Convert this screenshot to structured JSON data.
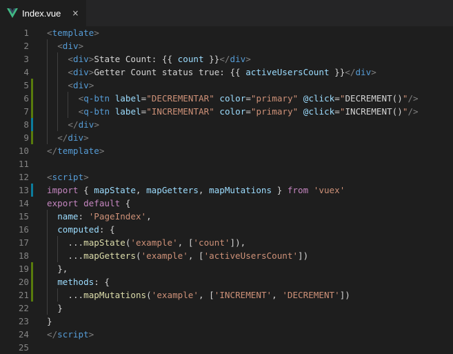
{
  "tab": {
    "label": "Index.vue",
    "close": "×",
    "icon": "vue-logo-icon",
    "vue_colors": [
      "#41b883",
      "#34495e"
    ]
  },
  "colors": {
    "background": "#1e1e1e",
    "gutter_text": "#858585",
    "git_modified": "#587c0c",
    "git_added": "#0c7d9d"
  },
  "lines": [
    {
      "n": "1",
      "marker": "",
      "indent": 0,
      "tokens": [
        [
          "punc",
          "<"
        ],
        [
          "tag",
          "template"
        ],
        [
          "punc",
          ">"
        ]
      ]
    },
    {
      "n": "2",
      "marker": "",
      "indent": 1,
      "tokens": [
        [
          "punc",
          "<"
        ],
        [
          "tag",
          "div"
        ],
        [
          "punc",
          ">"
        ]
      ]
    },
    {
      "n": "3",
      "marker": "",
      "indent": 2,
      "tokens": [
        [
          "punc",
          "<"
        ],
        [
          "tag",
          "div"
        ],
        [
          "punc",
          ">"
        ],
        [
          "text",
          "State Count: {{ "
        ],
        [
          "ident",
          "count"
        ],
        [
          "text",
          " }}"
        ],
        [
          "punc",
          "</"
        ],
        [
          "tag",
          "div"
        ],
        [
          "punc",
          ">"
        ]
      ]
    },
    {
      "n": "4",
      "marker": "",
      "indent": 2,
      "tokens": [
        [
          "punc",
          "<"
        ],
        [
          "tag",
          "div"
        ],
        [
          "punc",
          ">"
        ],
        [
          "text",
          "Getter Count status true: {{ "
        ],
        [
          "ident",
          "activeUsersCount"
        ],
        [
          "text",
          " }}"
        ],
        [
          "punc",
          "</"
        ],
        [
          "tag",
          "div"
        ],
        [
          "punc",
          ">"
        ]
      ]
    },
    {
      "n": "5",
      "marker": "green",
      "indent": 2,
      "tokens": [
        [
          "punc",
          "<"
        ],
        [
          "tag",
          "div"
        ],
        [
          "punc",
          ">"
        ]
      ]
    },
    {
      "n": "6",
      "marker": "green",
      "indent": 3,
      "tokens": [
        [
          "punc",
          "<"
        ],
        [
          "tag",
          "q-btn"
        ],
        [
          "plain",
          " "
        ],
        [
          "attr",
          "label"
        ],
        [
          "plain",
          "="
        ],
        [
          "str",
          "\"DECREMENTAR\""
        ],
        [
          "plain",
          " "
        ],
        [
          "attr",
          "color"
        ],
        [
          "plain",
          "="
        ],
        [
          "str",
          "\"primary\""
        ],
        [
          "plain",
          " "
        ],
        [
          "attr",
          "@click"
        ],
        [
          "plain",
          "="
        ],
        [
          "str",
          "\""
        ],
        [
          "plain",
          "DECREMENT()"
        ],
        [
          "str",
          "\""
        ],
        [
          "punc",
          "/>"
        ]
      ]
    },
    {
      "n": "7",
      "marker": "green",
      "indent": 3,
      "tokens": [
        [
          "punc",
          "<"
        ],
        [
          "tag",
          "q-btn"
        ],
        [
          "plain",
          " "
        ],
        [
          "attr",
          "label"
        ],
        [
          "plain",
          "="
        ],
        [
          "str",
          "\"INCREMENTAR\""
        ],
        [
          "plain",
          " "
        ],
        [
          "attr",
          "color"
        ],
        [
          "plain",
          "="
        ],
        [
          "str",
          "\"primary\""
        ],
        [
          "plain",
          " "
        ],
        [
          "attr",
          "@click"
        ],
        [
          "plain",
          "="
        ],
        [
          "str",
          "\""
        ],
        [
          "plain",
          "INCREMENT()"
        ],
        [
          "str",
          "\""
        ],
        [
          "punc",
          "/>"
        ]
      ]
    },
    {
      "n": "8",
      "marker": "blue",
      "indent": 2,
      "tokens": [
        [
          "punc",
          "</"
        ],
        [
          "tag",
          "div"
        ],
        [
          "punc",
          ">"
        ]
      ]
    },
    {
      "n": "9",
      "marker": "green",
      "indent": 1,
      "tokens": [
        [
          "punc",
          "</"
        ],
        [
          "tag",
          "div"
        ],
        [
          "punc",
          ">"
        ]
      ]
    },
    {
      "n": "10",
      "marker": "",
      "indent": 0,
      "tokens": [
        [
          "punc",
          "</"
        ],
        [
          "tag",
          "template"
        ],
        [
          "punc",
          ">"
        ]
      ]
    },
    {
      "n": "11",
      "marker": "",
      "indent": 0,
      "tokens": []
    },
    {
      "n": "12",
      "marker": "",
      "indent": 0,
      "tokens": [
        [
          "punc",
          "<"
        ],
        [
          "tag",
          "script"
        ],
        [
          "punc",
          ">"
        ]
      ]
    },
    {
      "n": "13",
      "marker": "blue",
      "indent": 0,
      "tokens": [
        [
          "kw",
          "import"
        ],
        [
          "plain",
          " { "
        ],
        [
          "ident",
          "mapState"
        ],
        [
          "plain",
          ", "
        ],
        [
          "ident",
          "mapGetters"
        ],
        [
          "plain",
          ", "
        ],
        [
          "ident",
          "mapMutations"
        ],
        [
          "plain",
          " } "
        ],
        [
          "kw",
          "from"
        ],
        [
          "plain",
          " "
        ],
        [
          "str",
          "'vuex'"
        ]
      ]
    },
    {
      "n": "14",
      "marker": "",
      "indent": 0,
      "tokens": [
        [
          "kw",
          "export"
        ],
        [
          "plain",
          " "
        ],
        [
          "kw",
          "default"
        ],
        [
          "plain",
          " {"
        ]
      ]
    },
    {
      "n": "15",
      "marker": "",
      "indent": 1,
      "tokens": [
        [
          "ident",
          "name"
        ],
        [
          "plain",
          ": "
        ],
        [
          "str",
          "'PageIndex'"
        ],
        [
          "plain",
          ","
        ]
      ]
    },
    {
      "n": "16",
      "marker": "",
      "indent": 1,
      "tokens": [
        [
          "ident",
          "computed"
        ],
        [
          "plain",
          ": {"
        ]
      ]
    },
    {
      "n": "17",
      "marker": "",
      "indent": 2,
      "tokens": [
        [
          "plain",
          "..."
        ],
        [
          "fn",
          "mapState"
        ],
        [
          "plain",
          "("
        ],
        [
          "str",
          "'example'"
        ],
        [
          "plain",
          ", ["
        ],
        [
          "str",
          "'count'"
        ],
        [
          "plain",
          "]),"
        ]
      ]
    },
    {
      "n": "18",
      "marker": "",
      "indent": 2,
      "tokens": [
        [
          "plain",
          "..."
        ],
        [
          "fn",
          "mapGetters"
        ],
        [
          "plain",
          "("
        ],
        [
          "str",
          "'example'"
        ],
        [
          "plain",
          ", ["
        ],
        [
          "str",
          "'activeUsersCount'"
        ],
        [
          "plain",
          "])"
        ]
      ]
    },
    {
      "n": "19",
      "marker": "green",
      "indent": 1,
      "tokens": [
        [
          "plain",
          "},"
        ]
      ]
    },
    {
      "n": "20",
      "marker": "green",
      "indent": 1,
      "tokens": [
        [
          "ident",
          "methods"
        ],
        [
          "plain",
          ": {"
        ]
      ]
    },
    {
      "n": "21",
      "marker": "green",
      "indent": 2,
      "tokens": [
        [
          "plain",
          "..."
        ],
        [
          "fn",
          "mapMutations"
        ],
        [
          "plain",
          "("
        ],
        [
          "str",
          "'example'"
        ],
        [
          "plain",
          ", ["
        ],
        [
          "str",
          "'INCREMENT'"
        ],
        [
          "plain",
          ", "
        ],
        [
          "str",
          "'DECREMENT'"
        ],
        [
          "plain",
          "])"
        ]
      ]
    },
    {
      "n": "22",
      "marker": "",
      "indent": 1,
      "tokens": [
        [
          "plain",
          "}"
        ]
      ]
    },
    {
      "n": "23",
      "marker": "",
      "indent": 0,
      "tokens": [
        [
          "plain",
          "}"
        ]
      ]
    },
    {
      "n": "24",
      "marker": "",
      "indent": 0,
      "tokens": [
        [
          "punc",
          "</"
        ],
        [
          "tag",
          "script"
        ],
        [
          "punc",
          ">"
        ]
      ]
    },
    {
      "n": "25",
      "marker": "",
      "indent": 0,
      "tokens": []
    }
  ]
}
